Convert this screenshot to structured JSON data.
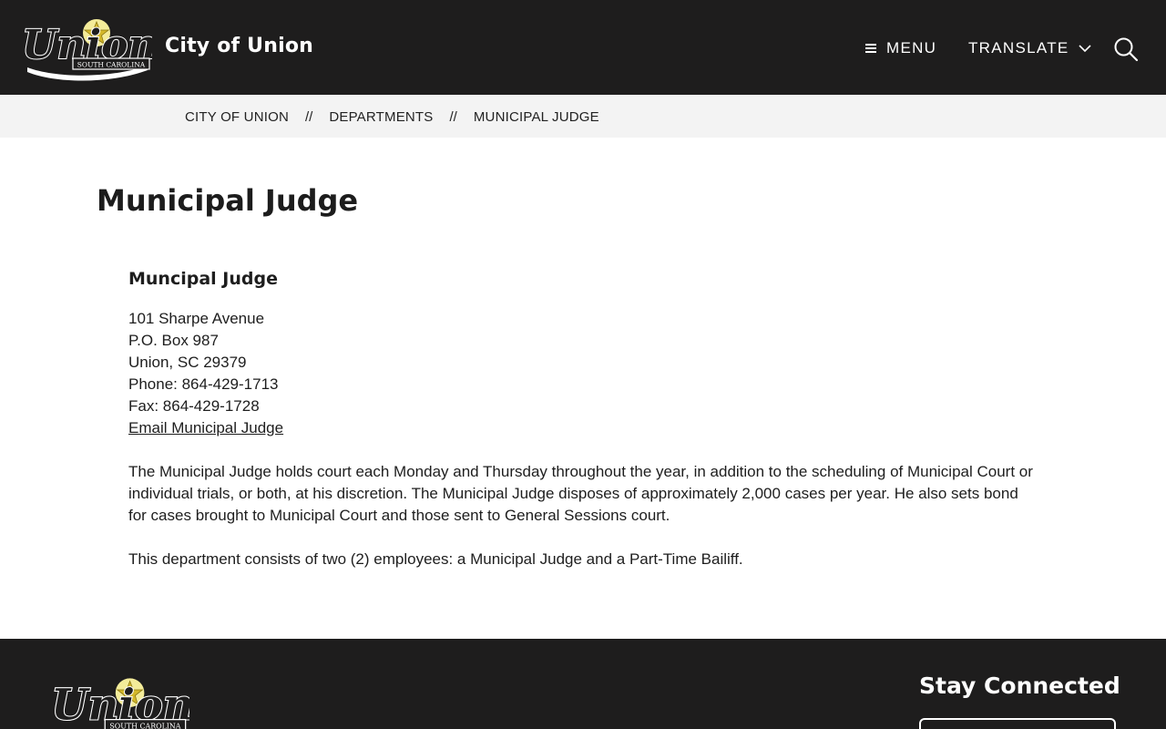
{
  "header": {
    "logo_text": "Union",
    "logo_subtext": "SOUTH CAROLINA",
    "site_title": "City of Union",
    "menu_label": "MENU",
    "translate_label": "TRANSLATE",
    "search_icon": "search-icon"
  },
  "breadcrumb": {
    "items": [
      "CITY OF UNION",
      "DEPARTMENTS",
      "MUNICIPAL JUDGE"
    ],
    "separator": "//"
  },
  "main": {
    "title": "Municipal Judge",
    "section_heading": "Muncipal Judge",
    "address": [
      "101 Sharpe Avenue",
      "P.O. Box 987",
      "Union, SC  29379",
      "Phone:  864-429-1713",
      "Fax:  864-429-1728"
    ],
    "email_link": "Email Municipal Judge",
    "paragraph_1": "The Municipal Judge holds court each Monday and Thursday throughout the year, in addition to the scheduling of Municipal Court or individual trials, or both, at his discretion.  The Municipal Judge disposes of approximately 2,000 cases per year.  He also sets bond for cases brought to Municipal Court and those sent to General Sessions court.",
    "paragraph_2": "This department consists of two (2) employees:  a Municipal Judge and a Part-Time Bailiff."
  },
  "footer": {
    "stay_connected": "Stay Connected"
  },
  "colors": {
    "header_bg": "#1e1d1d",
    "breadcrumb_bg": "#f3f3f3",
    "logo_star": "#e8d44d"
  }
}
